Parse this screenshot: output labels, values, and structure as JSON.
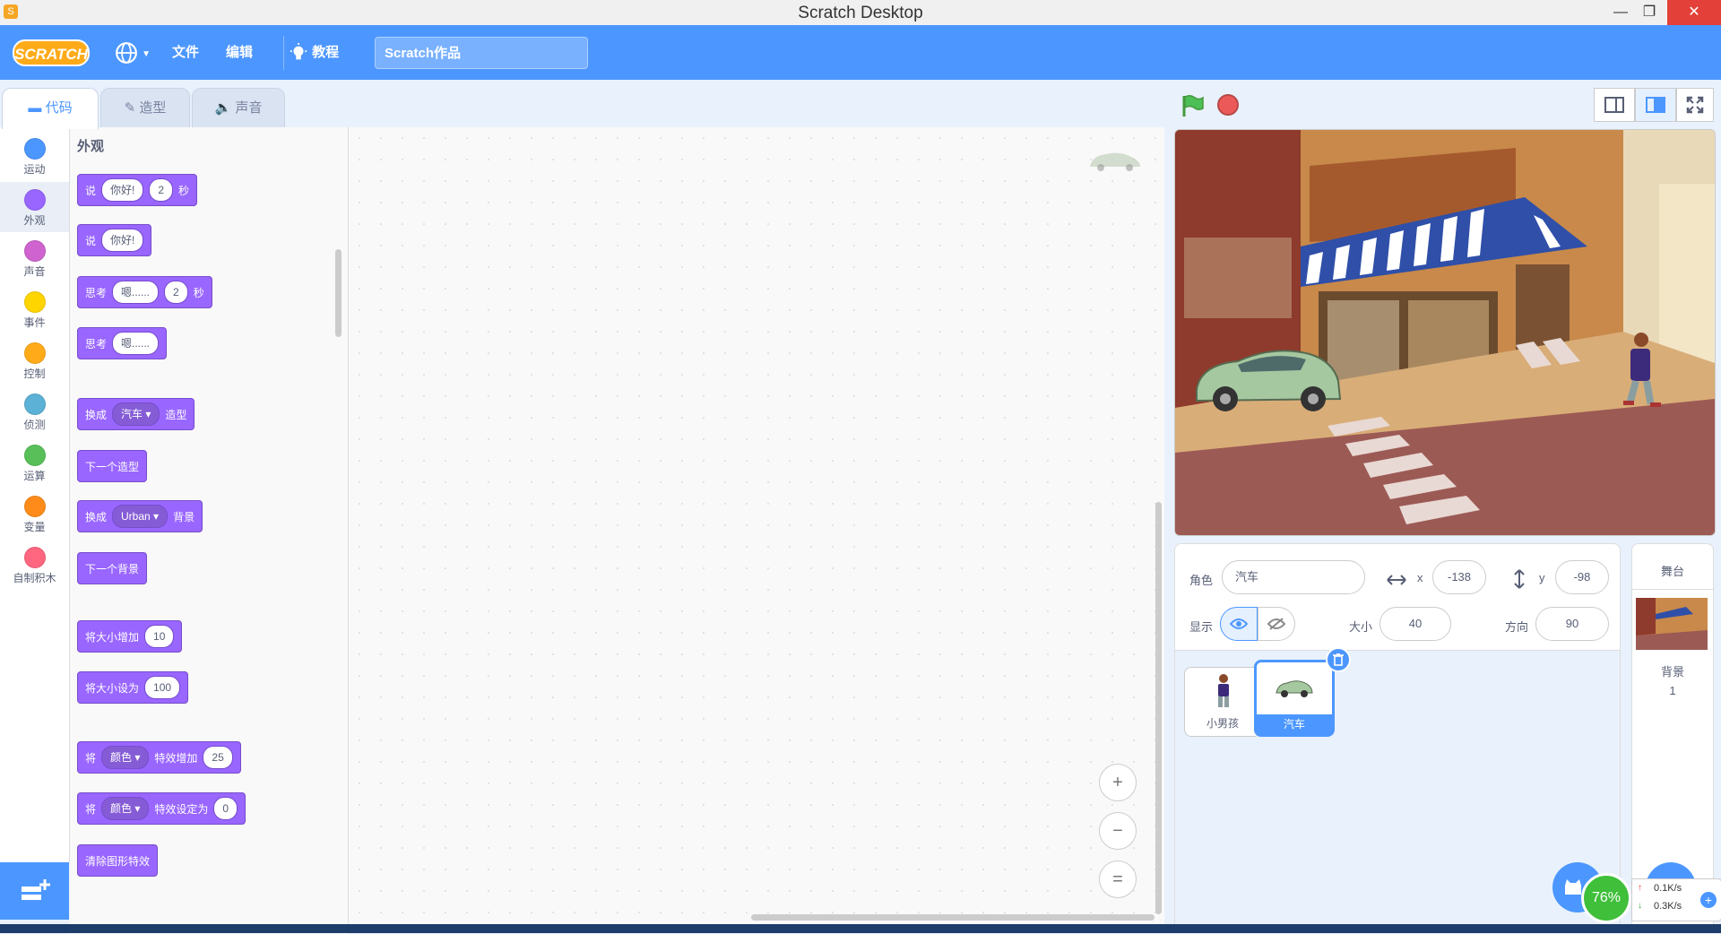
{
  "window": {
    "title": "Scratch Desktop",
    "minimize": "—",
    "maximize": "❐",
    "close": "✕"
  },
  "menubar": {
    "logo": "SCRATCH",
    "language_icon": "globe-icon",
    "file": "文件",
    "edit": "编辑",
    "tutorials": "教程",
    "project_title": "Scratch作品"
  },
  "tabs": [
    {
      "label": "代码",
      "icon": "code-icon",
      "active": true
    },
    {
      "label": "造型",
      "icon": "brush-icon",
      "active": false
    },
    {
      "label": "声音",
      "icon": "speaker-icon",
      "active": false
    }
  ],
  "categories": [
    {
      "label": "运动",
      "color": "#4c97ff"
    },
    {
      "label": "外观",
      "color": "#9966ff"
    },
    {
      "label": "声音",
      "color": "#cf63cf"
    },
    {
      "label": "事件",
      "color": "#ffd500"
    },
    {
      "label": "控制",
      "color": "#ffab19"
    },
    {
      "label": "侦测",
      "color": "#5cb1d6"
    },
    {
      "label": "运算",
      "color": "#59c059"
    },
    {
      "label": "变量",
      "color": "#ff8c1a"
    },
    {
      "label": "自制积木",
      "color": "#ff6680"
    }
  ],
  "palette": {
    "title": "外观",
    "blocks": {
      "say_secs": {
        "a": "说",
        "text": "你好!",
        "num": "2",
        "b": "秒"
      },
      "say": {
        "a": "说",
        "text": "你好!"
      },
      "think_secs": {
        "a": "思考",
        "text": "嗯......",
        "num": "2",
        "b": "秒"
      },
      "think": {
        "a": "思考",
        "text": "嗯......"
      },
      "switch_costume": {
        "a": "换成",
        "dd": "汽车",
        "b": "造型"
      },
      "next_costume": {
        "a": "下一个造型"
      },
      "switch_backdrop": {
        "a": "换成",
        "dd": "Urban",
        "b": "背景"
      },
      "next_backdrop": {
        "a": "下一个背景"
      },
      "change_size": {
        "a": "将大小增加",
        "num": "10"
      },
      "set_size": {
        "a": "将大小设为",
        "num": "100"
      },
      "change_effect": {
        "a": "将",
        "dd": "颜色",
        "b": "特效增加",
        "num": "25"
      },
      "set_effect": {
        "a": "将",
        "dd": "颜色",
        "b": "特效设定为",
        "num": "0"
      },
      "clear_effects": {
        "a": "清除图形特效"
      }
    }
  },
  "zoom": {
    "in": "+",
    "out": "−",
    "reset": "="
  },
  "sprite_info": {
    "sprite_label": "角色",
    "sprite_name": "汽车",
    "x_label": "x",
    "x_value": "-138",
    "y_label": "y",
    "y_value": "-98",
    "show_label": "显示",
    "size_label": "大小",
    "size_value": "40",
    "direction_label": "方向",
    "direction_value": "90"
  },
  "sprites": [
    {
      "name": "小男孩",
      "selected": false
    },
    {
      "name": "汽车",
      "selected": true
    }
  ],
  "stage_pane": {
    "title": "舞台",
    "backdrop_label": "背景",
    "backdrop_count": "1"
  },
  "net_widget": {
    "percent": "76%",
    "up": "0.1K/s",
    "down": "0.3K/s"
  },
  "colors": {
    "menubar": "#4c97ff",
    "looks": "#9966ff",
    "accent": "#4c97ff"
  }
}
